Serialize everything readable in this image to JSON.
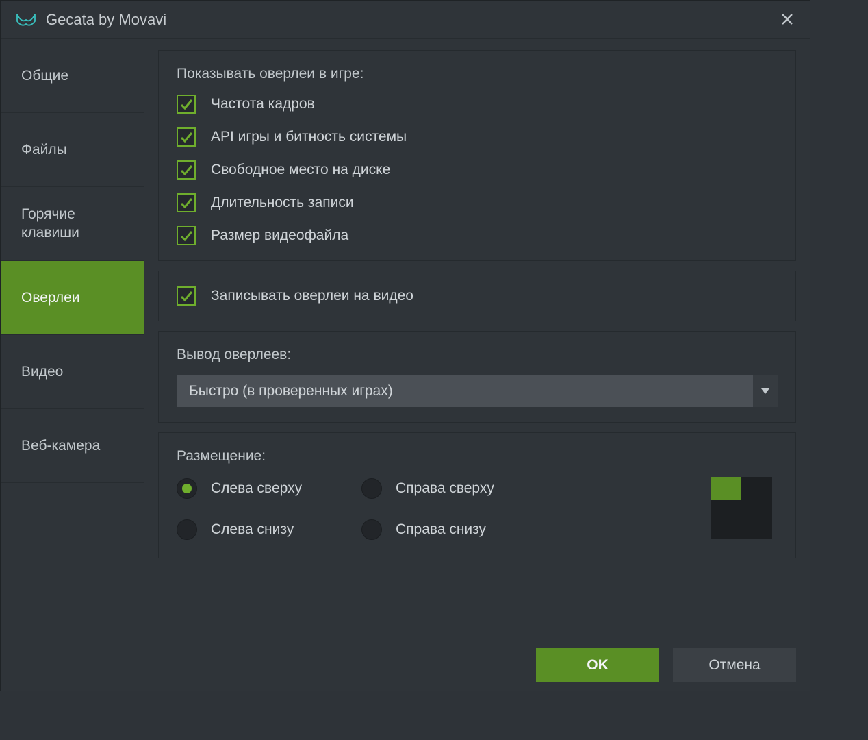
{
  "window": {
    "title": "Gecata by Movavi"
  },
  "sidebar": {
    "items": [
      {
        "label": "Общие"
      },
      {
        "label": "Файлы"
      },
      {
        "label_line1": "Горячие",
        "label_line2": "клавиши"
      },
      {
        "label": "Оверлеи"
      },
      {
        "label": "Видео"
      },
      {
        "label": "Веб-камера"
      }
    ]
  },
  "overlays_section": {
    "title": "Показывать оверлеи в игре:",
    "items": [
      "Частота кадров",
      "API игры и битность системы",
      "Свободное место на диске",
      "Длительность записи",
      "Размер видеофайла"
    ]
  },
  "record_overlay_label": "Записывать оверлеи на видео",
  "output": {
    "title": "Вывод оверлеев:",
    "selected": "Быстро (в проверенных играх)"
  },
  "placement": {
    "title": "Размещение:",
    "options": {
      "top_left": "Слева сверху",
      "top_right": "Справа сверху",
      "bottom_left": "Слева снизу",
      "bottom_right": "Справа снизу"
    }
  },
  "footer": {
    "ok": "OK",
    "cancel": "Отмена"
  },
  "colors": {
    "accent": "#5a8f25",
    "accent_bright": "#6fae2d"
  }
}
